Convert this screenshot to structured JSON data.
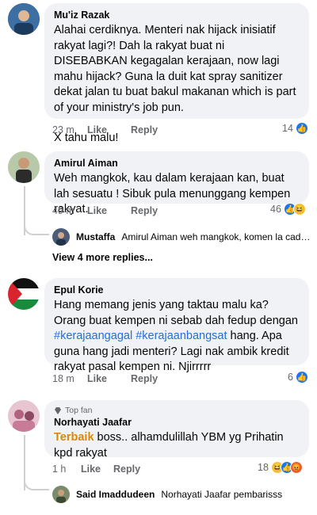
{
  "comments": [
    {
      "author": "Mu'iz Razak",
      "text": "Alahai cerdiknya. Menteri nak hijack inisiatif rakyat lagi?! Dah la rakyat buat ni DISEBABKAN kegagalan kerajaan, now lagi mahu hijack? Guna la duit kat spray sanitizer dekat jalan tu buat bakul makanan which is part of your ministry's job pun.",
      "text2": "X tahu malu!",
      "time": "23 m",
      "like_label": "Like",
      "reply_label": "Reply",
      "reaction_count": "14",
      "reactions": [
        "like"
      ]
    },
    {
      "author": "Amirul Aiman",
      "text": "Weh mangkok, kau dalam kerajaan kan, buat lah sesuatu ! Sibuk pula menunggang kempen rakyat.",
      "time": "49 m",
      "like_label": "Like",
      "reply_label": "Reply",
      "reaction_count": "46",
      "reactions": [
        "like",
        "haha"
      ],
      "reply_preview": {
        "author": "Mustaffa",
        "text": "Amirul Aiman weh mangkok, komen la cadanga..."
      },
      "more_replies": "View 4 more replies..."
    },
    {
      "author": "Epul Korie",
      "text_a": "Hang memang jenis yang taktau malu ka? Orang buat kempen ni sebab dah fedup dengan ",
      "hashtag1": "#kerajaangagal",
      "hashtag2": "#kerajaanbangsat",
      "text_b": " hang. Apa guna hang jadi menteri? Lagi nak ambik kredit rakyat pasal kempen ni. Njirrrrr",
      "time": "18 m",
      "like_label": "Like",
      "reply_label": "Reply",
      "reaction_count": "6",
      "reactions": [
        "like"
      ]
    },
    {
      "badge": "Top fan",
      "author": "Norhayati Jaafar",
      "highlight": "Terbaik",
      "text": " boss.. alhamdulillah YBM yg Prihatin kpd rakyat",
      "time": "1 h",
      "like_label": "Like",
      "reply_label": "Reply",
      "reaction_count": "18",
      "reactions": [
        "haha",
        "like",
        "angry"
      ],
      "reply_preview": {
        "author": "Said Imaddudeen",
        "text": "Norhayati Jaafar pembarisss"
      }
    }
  ],
  "colors": {
    "bubble": "#f0f2f5",
    "meta": "#65676b",
    "hashtag": "#216fdb",
    "like_blue": "#1877f2"
  }
}
